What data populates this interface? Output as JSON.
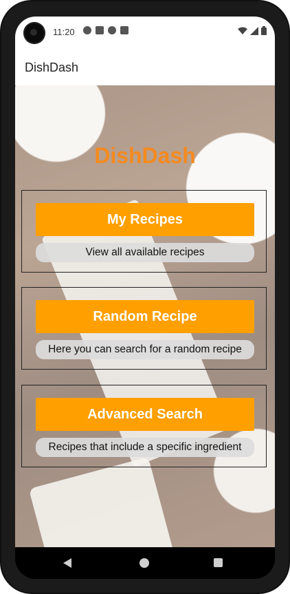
{
  "status_bar": {
    "time": "11:20",
    "left_icons": [
      "notification-icon",
      "notification-icon",
      "notification-icon",
      "sd-card-icon"
    ],
    "right_icons": [
      "wifi-icon",
      "signal-icon",
      "battery-icon"
    ]
  },
  "app_bar": {
    "title": "DishDash"
  },
  "main": {
    "hero_title": "DishDash",
    "accent_color": "#ff9f00",
    "title_color": "#f58a1f",
    "cards": [
      {
        "button_label": "My Recipes",
        "description": "View all available recipes"
      },
      {
        "button_label": "Random Recipe",
        "description": "Here you can search for a random recipe"
      },
      {
        "button_label": "Advanced Search",
        "description": "Recipes that include a specific ingredient"
      }
    ]
  },
  "nav_bar": {
    "buttons": [
      "back-icon",
      "home-icon",
      "recents-icon"
    ]
  }
}
